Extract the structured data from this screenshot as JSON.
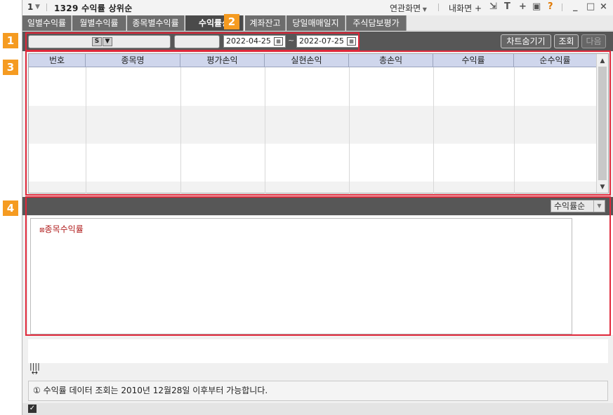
{
  "window": {
    "screen_number": "1",
    "screen_title": "1329 수익률 상위순",
    "links": {
      "related": "연관화면",
      "my_screen": "내화면"
    }
  },
  "tabs": [
    {
      "label": "일별수익률"
    },
    {
      "label": "월별수익률"
    },
    {
      "label": "종목별수익률"
    },
    {
      "label": "수익률상"
    },
    {
      "label": "계좌잔고"
    },
    {
      "label": "당일매매일지"
    },
    {
      "label": "주식담보평가"
    }
  ],
  "toolbar": {
    "account_type_button": "S",
    "start_date": "2022-04-25",
    "range_sep": "~",
    "end_date": "2022-07-25",
    "chart_toggle": "차트숨기기",
    "query": "조회",
    "next": "다음"
  },
  "grid": {
    "columns": [
      "번호",
      "종목명",
      "평가손익",
      "실현손익",
      "총손익",
      "수익률",
      "순수익률"
    ],
    "rows": []
  },
  "chart_panel": {
    "sort_option": "수익률순",
    "legend": "종목수익률"
  },
  "notice": "① 수익률 데이터 조회는 2010년 12월28일 이후부터 가능합니다.",
  "callouts": [
    "1",
    "2",
    "3",
    "4"
  ],
  "colors": {
    "callout": "#f59b21",
    "frame": "#e0283a",
    "grid_header": "#cfd6ec",
    "legend": "#b01c1c"
  }
}
